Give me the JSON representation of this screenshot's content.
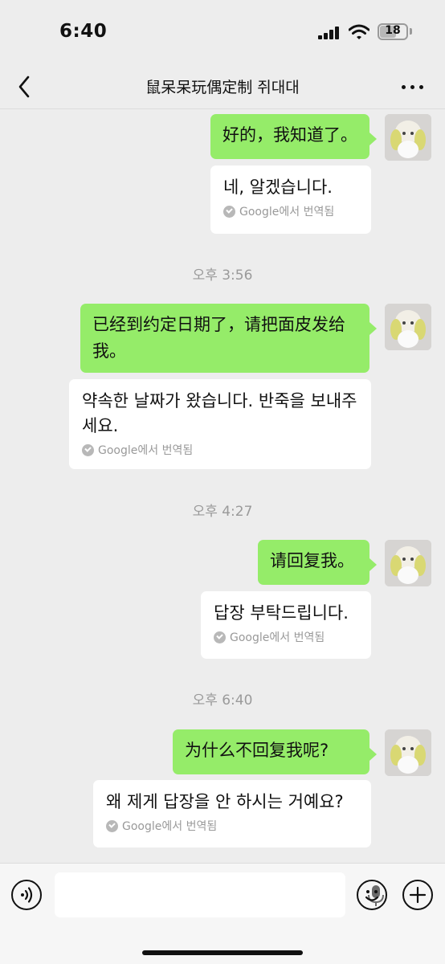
{
  "status_bar": {
    "time": "6:40",
    "battery_level": "18"
  },
  "nav": {
    "title": "鼠呆呆玩偶定制 쥐대대"
  },
  "translation_badge": "Google에서 번역됨",
  "messages": [
    {
      "text": "好的，我知道了。",
      "translation": "네, 알겠습니다."
    },
    {
      "timestamp": "오후 3:56",
      "text": "已经到约定日期了，请把面皮发给我。",
      "translation": "약속한 날짜가 왔습니다. 반죽을 보내주세요."
    },
    {
      "timestamp": "오후 4:27",
      "text": "请回复我。",
      "translation": "답장 부탁드립니다."
    },
    {
      "timestamp": "오후 6:40",
      "text": "为什么不回复我呢?",
      "translation": "왜 제게 답장을 안 하시는 거예요?"
    }
  ],
  "icons": {
    "back": "chevron-left-icon",
    "more": "more-dots-icon",
    "voice": "voice-input-icon",
    "mic": "microphone-icon",
    "emoji": "emoji-icon",
    "add": "plus-icon"
  },
  "colors": {
    "self_bubble": "#95ec69",
    "translation_bubble": "#ffffff",
    "background": "#ededed"
  }
}
